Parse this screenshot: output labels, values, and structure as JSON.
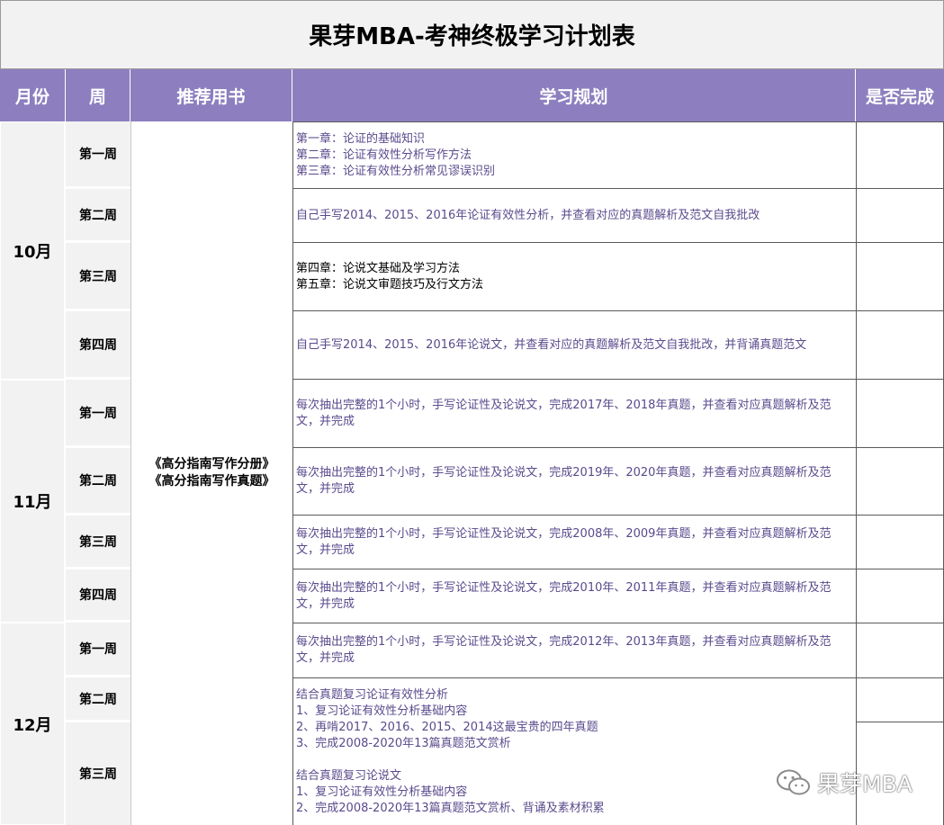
{
  "title": "果芽MBA-考神终极学习计划表",
  "headers": {
    "month": "月份",
    "week": "周",
    "book": "推荐用书",
    "plan": "学习规划",
    "done": "是否完成"
  },
  "months": [
    "10月",
    "11月",
    "12月"
  ],
  "weeks": [
    "第一周",
    "第二周",
    "第三周",
    "第四周",
    "第一周",
    "第二周",
    "第三周",
    "第四周",
    "第一周",
    "第二周",
    "第三周"
  ],
  "book": {
    "line1": "《高分指南写作分册》",
    "line2": "《高分指南写作真题》"
  },
  "plans": [
    "第一章：论证的基础知识\n第二章：论证有效性分析写作方法\n第三章：论证有效性分析常见谬误识别",
    "自己手写2014、2015、2016年论证有效性分析，并查看对应的真题解析及范文自我批改",
    "第四章：论说文基础及学习方法\n第五章：论说文审题技巧及行文方法",
    "自己手写2014、2015、2016年论说文，并查看对应的真题解析及范文自我批改，并背诵真题范文",
    "每次抽出完整的1个小时，手写论证性及论说文，完成2017年、2018年真题，并查看对应真题解析及范文，并完成",
    "每次抽出完整的1个小时，手写论证性及论说文，完成2019年、2020年真题，并查看对应真题解析及范文，并完成",
    "每次抽出完整的1个小时，手写论证性及论说文，完成2008年、2009年真题，并查看对应真题解析及范文，并完成",
    "每次抽出完整的1个小时，手写论证性及论说文，完成2010年、2011年真题，并查看对应真题解析及范文，并完成",
    "每次抽出完整的1个小时，手写论证性及论说文，完成2012年、2013年真题，并查看对应真题解析及范文，并完成",
    "结合真题复习论证有效性分析\n1、复习论证有效性分析基础内容\n2、再啃2017、2016、2015、2014这最宝贵的四年真题\n3、完成2008-2020年13篇真题范文赏析\n\n结合真题复习论说文\n1、复习论证有效性分析基础内容\n2、完成2008-2020年13篇真题范文赏析、背诵及素材积累"
  ],
  "watermark": "果芽MBA",
  "icons": {
    "watermark": "wechat-icon"
  }
}
